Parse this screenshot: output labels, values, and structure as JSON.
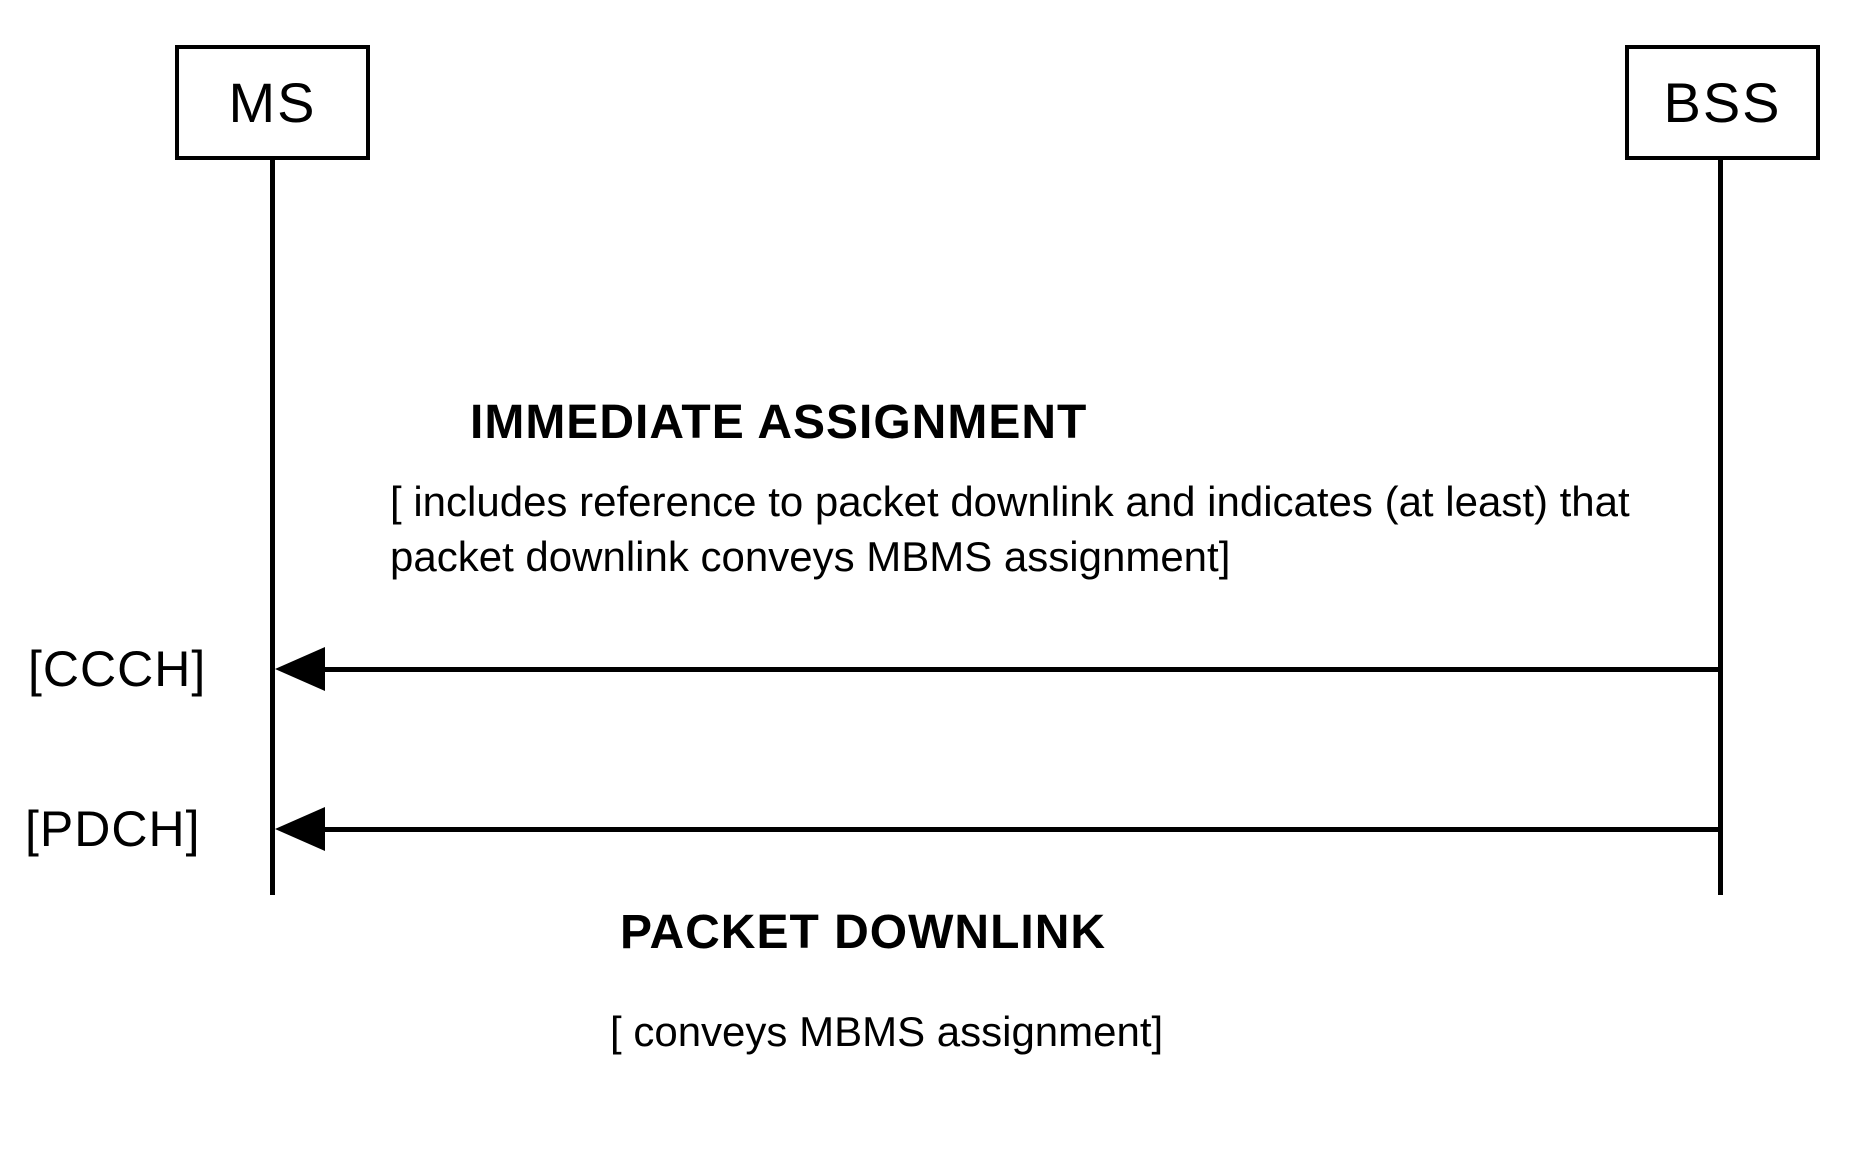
{
  "entities": {
    "ms": "MS",
    "bss": "BSS"
  },
  "channels": {
    "ccch": "[CCCH]",
    "pdch": "[PDCH]"
  },
  "messages": {
    "immediate": {
      "title": "IMMEDIATE ASSIGNMENT",
      "description": "[ includes reference to packet downlink and indicates (at least) that packet downlink conveys MBMS assignment]"
    },
    "packet": {
      "title": "PACKET DOWNLINK",
      "description": "[ conveys MBMS assignment]"
    }
  }
}
